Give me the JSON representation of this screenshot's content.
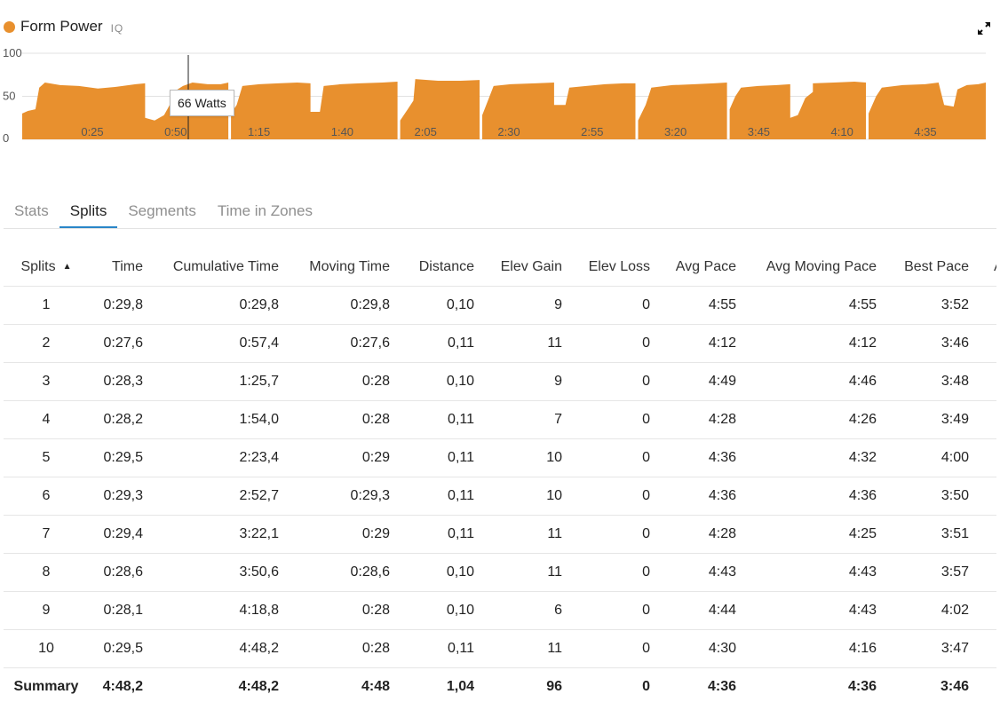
{
  "chart": {
    "title": "Form Power",
    "badge": "IQ",
    "series_color": "#E8902E",
    "tooltip": "66 Watts"
  },
  "chart_data": {
    "type": "area",
    "title": "Form Power",
    "xlabel": "",
    "ylabel": "",
    "ylim": [
      0,
      100
    ],
    "yticks": [
      "100",
      "50",
      "0"
    ],
    "xticks": [
      "0:25",
      "0:50",
      "1:15",
      "1:40",
      "2:05",
      "2:30",
      "2:55",
      "3:20",
      "3:45",
      "4:10",
      "4:35"
    ],
    "xlim": [
      0,
      290
    ],
    "segments": [
      [
        [
          0,
          0
        ],
        [
          0,
          30
        ],
        [
          3,
          33
        ],
        [
          7,
          35
        ],
        [
          9,
          60
        ],
        [
          12,
          66
        ],
        [
          20,
          63
        ],
        [
          30,
          62
        ],
        [
          40,
          59
        ],
        [
          50,
          61
        ],
        [
          60,
          64
        ],
        [
          65,
          65
        ],
        [
          65,
          25
        ],
        [
          70,
          22
        ],
        [
          75,
          28
        ],
        [
          78,
          40
        ],
        [
          80,
          55
        ],
        [
          85,
          62
        ],
        [
          90,
          66
        ],
        [
          98,
          64
        ],
        [
          105,
          64
        ],
        [
          109,
          66
        ],
        [
          109,
          0
        ]
      ],
      [
        [
          0,
          0
        ],
        [
          0,
          30
        ],
        [
          3,
          40
        ],
        [
          6,
          62
        ],
        [
          15,
          64
        ],
        [
          25,
          65
        ],
        [
          35,
          66
        ],
        [
          42,
          65
        ],
        [
          42,
          32
        ],
        [
          47,
          32
        ],
        [
          49,
          62
        ],
        [
          58,
          64
        ],
        [
          68,
          65
        ],
        [
          80,
          66
        ],
        [
          88,
          67
        ],
        [
          88,
          0
        ]
      ],
      [
        [
          0,
          0
        ],
        [
          0,
          22
        ],
        [
          4,
          35
        ],
        [
          7,
          45
        ],
        [
          8,
          70
        ],
        [
          20,
          68
        ],
        [
          32,
          68
        ],
        [
          42,
          69
        ],
        [
          42,
          0
        ]
      ],
      [
        [
          0,
          0
        ],
        [
          0,
          28
        ],
        [
          3,
          45
        ],
        [
          6,
          62
        ],
        [
          15,
          64
        ],
        [
          28,
          65
        ],
        [
          38,
          66
        ],
        [
          38,
          40
        ],
        [
          44,
          40
        ],
        [
          46,
          60
        ],
        [
          55,
          62
        ],
        [
          65,
          64
        ],
        [
          75,
          65
        ],
        [
          81,
          65
        ],
        [
          81,
          0
        ]
      ],
      [
        [
          0,
          0
        ],
        [
          0,
          22
        ],
        [
          4,
          40
        ],
        [
          7,
          60
        ],
        [
          18,
          63
        ],
        [
          30,
          64
        ],
        [
          40,
          65
        ],
        [
          47,
          66
        ],
        [
          47,
          0
        ]
      ],
      [
        [
          0,
          0
        ],
        [
          0,
          35
        ],
        [
          3,
          50
        ],
        [
          6,
          60
        ],
        [
          15,
          62
        ],
        [
          25,
          63
        ],
        [
          32,
          64
        ],
        [
          32,
          25
        ],
        [
          36,
          28
        ],
        [
          40,
          48
        ],
        [
          44,
          55
        ],
        [
          44,
          65
        ],
        [
          55,
          66
        ],
        [
          66,
          67
        ],
        [
          72,
          66
        ],
        [
          72,
          0
        ]
      ],
      [
        [
          0,
          0
        ],
        [
          0,
          30
        ],
        [
          4,
          50
        ],
        [
          7,
          60
        ],
        [
          18,
          63
        ],
        [
          30,
          64
        ],
        [
          37,
          66
        ],
        [
          40,
          40
        ],
        [
          45,
          38
        ],
        [
          47,
          58
        ],
        [
          52,
          63
        ],
        [
          58,
          64
        ],
        [
          62,
          66
        ],
        [
          62,
          0
        ]
      ]
    ]
  },
  "tabs": [
    "Stats",
    "Splits",
    "Segments",
    "Time in Zones"
  ],
  "table": {
    "headers": [
      "Splits",
      "Time",
      "Cumulative Time",
      "Moving Time",
      "Distance",
      "Elev Gain",
      "Elev Loss",
      "Avg Pace",
      "Avg Moving Pace",
      "Best Pace",
      "A"
    ],
    "rows": [
      [
        "1",
        "0:29,8",
        "0:29,8",
        "0:29,8",
        "0,10",
        "9",
        "0",
        "4:55",
        "4:55",
        "3:52",
        ""
      ],
      [
        "2",
        "0:27,6",
        "0:57,4",
        "0:27,6",
        "0,11",
        "11",
        "0",
        "4:12",
        "4:12",
        "3:46",
        ""
      ],
      [
        "3",
        "0:28,3",
        "1:25,7",
        "0:28",
        "0,10",
        "9",
        "0",
        "4:49",
        "4:46",
        "3:48",
        ""
      ],
      [
        "4",
        "0:28,2",
        "1:54,0",
        "0:28",
        "0,11",
        "7",
        "0",
        "4:28",
        "4:26",
        "3:49",
        ""
      ],
      [
        "5",
        "0:29,5",
        "2:23,4",
        "0:29",
        "0,11",
        "10",
        "0",
        "4:36",
        "4:32",
        "4:00",
        ""
      ],
      [
        "6",
        "0:29,3",
        "2:52,7",
        "0:29,3",
        "0,11",
        "10",
        "0",
        "4:36",
        "4:36",
        "3:50",
        ""
      ],
      [
        "7",
        "0:29,4",
        "3:22,1",
        "0:29",
        "0,11",
        "11",
        "0",
        "4:28",
        "4:25",
        "3:51",
        ""
      ],
      [
        "8",
        "0:28,6",
        "3:50,6",
        "0:28,6",
        "0,10",
        "11",
        "0",
        "4:43",
        "4:43",
        "3:57",
        ""
      ],
      [
        "9",
        "0:28,1",
        "4:18,8",
        "0:28",
        "0,10",
        "6",
        "0",
        "4:44",
        "4:43",
        "4:02",
        ""
      ],
      [
        "10",
        "0:29,5",
        "4:48,2",
        "0:28",
        "0,11",
        "11",
        "0",
        "4:30",
        "4:16",
        "3:47",
        ""
      ]
    ],
    "summary": [
      "Summary",
      "4:48,2",
      "4:48,2",
      "4:48",
      "1,04",
      "96",
      "0",
      "4:36",
      "4:36",
      "3:46",
      ""
    ]
  }
}
